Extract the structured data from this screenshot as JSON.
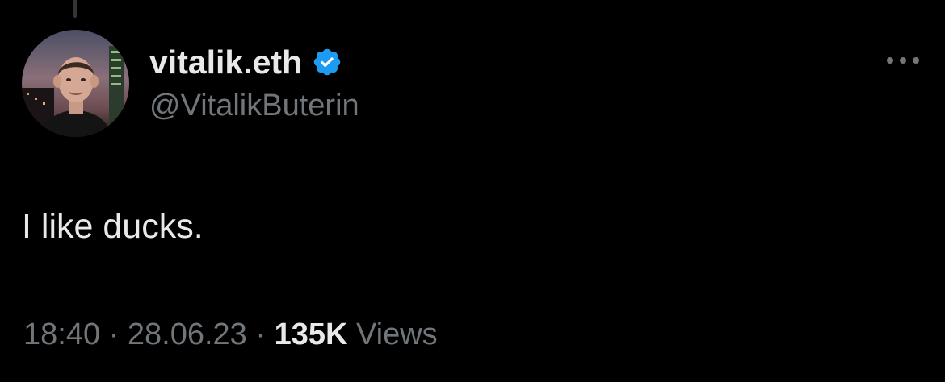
{
  "tweet": {
    "author": {
      "display_name": "vitalik.eth",
      "handle": "@VitalikButerin",
      "verified": true,
      "verified_color": "#1d9bf0"
    },
    "text": "I like ducks.",
    "meta": {
      "time": "18:40",
      "separator": "·",
      "date": "28.06.23",
      "views_count": "135K",
      "views_label": "Views"
    }
  },
  "icons": {
    "more": "more-horizontal-icon",
    "verified": "verified-badge-icon"
  },
  "colors": {
    "background": "#000000",
    "primary_text": "#e7e9ea",
    "secondary_text": "#71767b",
    "accent": "#1d9bf0"
  }
}
